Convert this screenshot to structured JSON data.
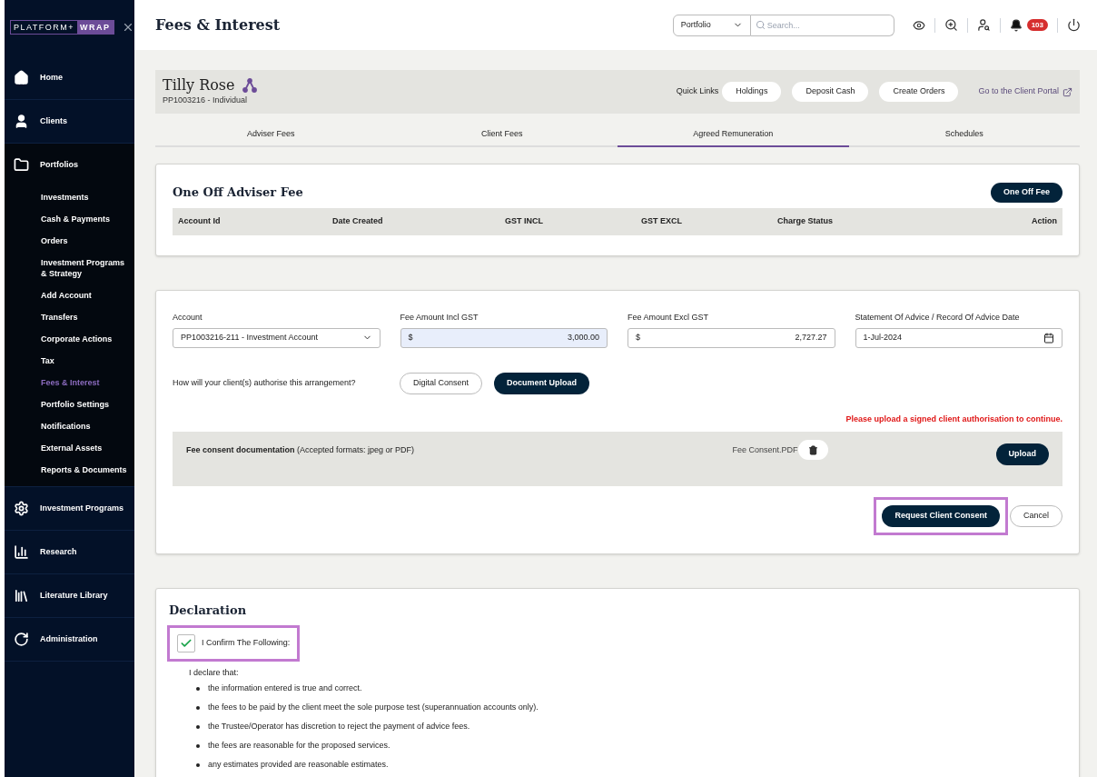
{
  "logo": {
    "left": "PLATFORM+",
    "right": "WRAP"
  },
  "sidebar": {
    "items": [
      {
        "label": "Home",
        "expanded": false
      },
      {
        "label": "Clients",
        "expanded": false
      },
      {
        "label": "Portfolios",
        "expanded": true,
        "children": [
          {
            "label": "Investments",
            "selected": false
          },
          {
            "label": "Cash & Payments",
            "selected": false
          },
          {
            "label": "Orders",
            "selected": false
          },
          {
            "label": "Investment Programs & Strategy",
            "selected": false
          },
          {
            "label": "Add Account",
            "selected": false
          },
          {
            "label": "Transfers",
            "selected": false
          },
          {
            "label": "Corporate Actions",
            "selected": false
          },
          {
            "label": "Tax",
            "selected": false
          },
          {
            "label": "Fees & Interest",
            "selected": true
          },
          {
            "label": "Portfolio Settings",
            "selected": false
          },
          {
            "label": "Notifications",
            "selected": false
          },
          {
            "label": "External Assets",
            "selected": false
          },
          {
            "label": "Reports & Documents",
            "selected": false
          }
        ]
      },
      {
        "label": "Investment Programs",
        "expanded": false
      },
      {
        "label": "Research",
        "expanded": false
      },
      {
        "label": "Literature Library",
        "expanded": false
      },
      {
        "label": "Administration",
        "expanded": false
      }
    ]
  },
  "header": {
    "title": "Fees & Interest",
    "search_scope": "Portfolio",
    "search_placeholder": "Search...",
    "notification_count": "103"
  },
  "client": {
    "name": "Tilly Rose",
    "subtitle": "PP1003216 - Individual",
    "quick_links_label": "Quick Links",
    "quick_links": [
      "Holdings",
      "Deposit Cash",
      "Create Orders"
    ],
    "portal_link": "Go to the Client Portal"
  },
  "tabs": [
    {
      "label": "Adviser Fees",
      "selected": false
    },
    {
      "label": "Client Fees",
      "selected": false
    },
    {
      "label": "Agreed Remuneration",
      "selected": true
    },
    {
      "label": "Schedules",
      "selected": false
    }
  ],
  "one_off_fee": {
    "title": "One Off Adviser Fee",
    "button": "One Off Fee",
    "columns": [
      "Account Id",
      "Date Created",
      "GST INCL",
      "GST EXCL",
      "Charge Status",
      "Action"
    ]
  },
  "form": {
    "fields": [
      {
        "kind": "select",
        "label": "Account",
        "value": "PP1003216-211 - Investment Account",
        "highlighted": false
      },
      {
        "kind": "money",
        "label": "Fee Amount Incl GST",
        "prefix": "$",
        "value": "3,000.00",
        "highlighted": true
      },
      {
        "kind": "money",
        "label": "Fee Amount Excl GST",
        "prefix": "$",
        "value": "2,727.27",
        "highlighted": false
      },
      {
        "kind": "date",
        "label": "Statement Of Advice / Record Of Advice Date",
        "value": "1-Jul-2024",
        "highlighted": false
      }
    ],
    "authorise_question": "How will your client(s) authorise this arrangement?",
    "consent_options": [
      {
        "label": "Digital Consent",
        "selected": false
      },
      {
        "label": "Document Upload",
        "selected": true
      }
    ],
    "error": "Please upload a signed client authorisation to continue.",
    "upload": {
      "label": "**Fee consent documentation** (Accepted formats: jpeg or PDF)",
      "file": "Fee Consent.PDF",
      "button": "Upload"
    },
    "submit": {
      "label": "Request Client Consent",
      "highlighted": true
    },
    "cancel": "Cancel"
  },
  "declaration": {
    "title": "Declaration",
    "confirm_label": "I Confirm The Following:",
    "checked": true,
    "highlighted": true,
    "intro": "I declare that:",
    "items": [
      "the information entered is true and correct.",
      "the fees to be paid by the client meet the sole purpose test (superannuation accounts only).",
      "the Trustee/Operator has discretion to reject the payment of advice fees.",
      "the fees are reasonable for the proposed services.",
      "any estimates provided are reasonable estimates."
    ]
  }
}
